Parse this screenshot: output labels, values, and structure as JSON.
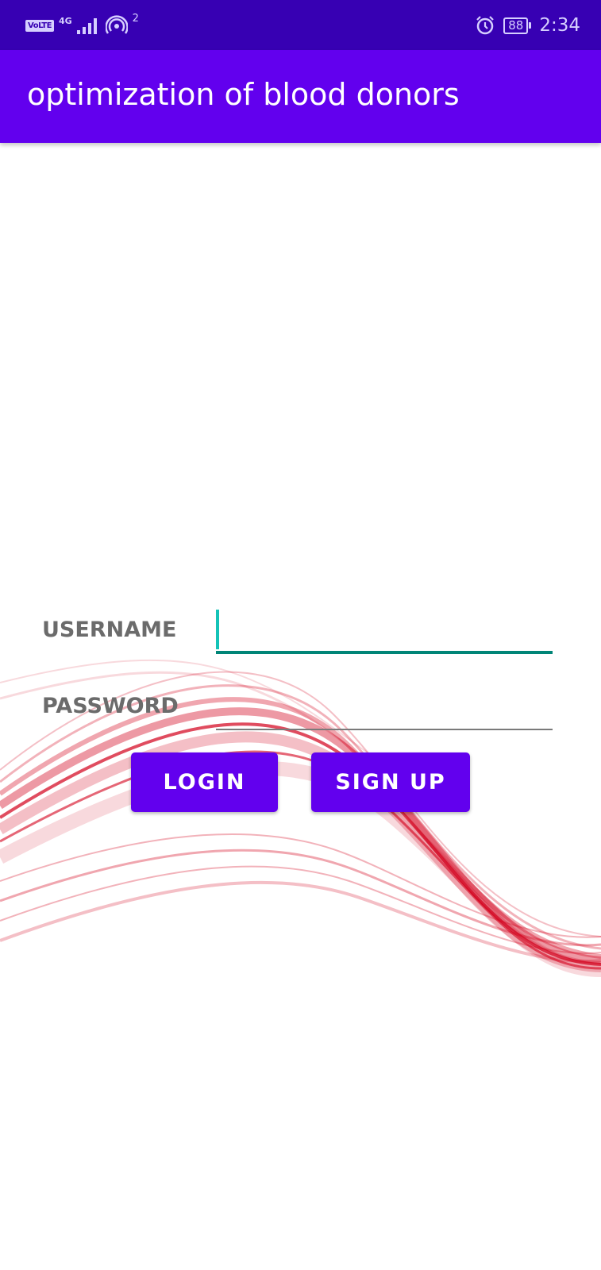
{
  "status_bar": {
    "network_badge": "VoLTE",
    "network_type": "4G",
    "hotspot_count": "2",
    "battery_level": "88",
    "time": "2:34",
    "icons": [
      "volte-icon",
      "signal-icon",
      "hotspot-icon",
      "alarm-icon",
      "battery-icon"
    ]
  },
  "app_bar": {
    "title": "optimization of blood donors"
  },
  "form": {
    "username_label": "USERNAME",
    "username_value": "",
    "password_label": "PASSWORD",
    "password_value": ""
  },
  "buttons": {
    "login": "LOGIN",
    "signup": "SIGN UP"
  },
  "colors": {
    "status_bar": "#3700b3",
    "app_bar": "#6200ee",
    "button": "#6200ee",
    "focused_underline": "#008577",
    "cursor": "#14c3b7",
    "wave_red": "#d3001b"
  }
}
